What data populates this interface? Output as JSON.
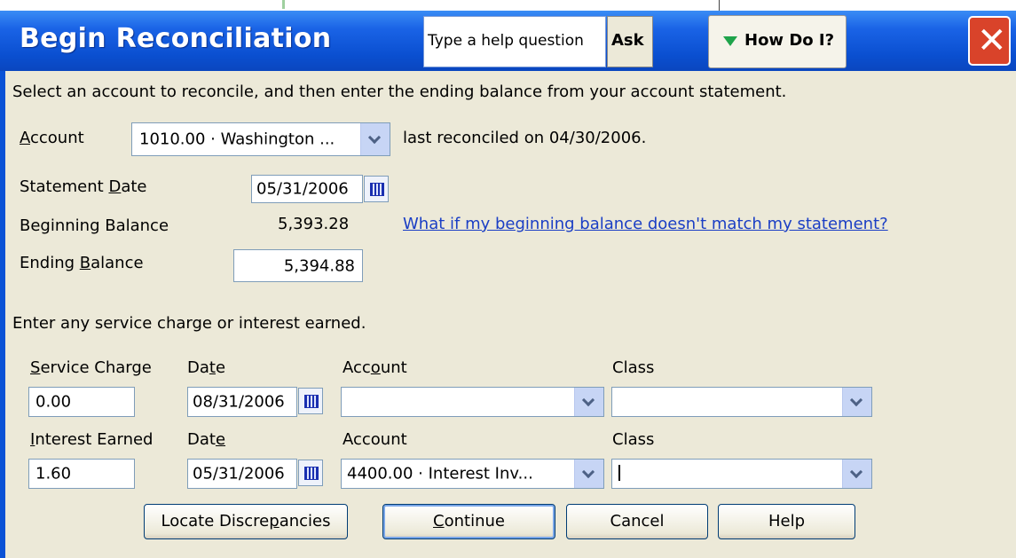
{
  "window": {
    "title": "Begin Reconciliation",
    "help_placeholder": "Type a help question",
    "ask_label": "Ask",
    "howdoi_label": "How Do I?",
    "close_glyph": "✕"
  },
  "intro": "Select an account to reconcile, and then enter the ending balance from your account statement.",
  "account": {
    "label_accel": "A",
    "label_rest": "ccount",
    "value": "1010.00 · Washington ...",
    "last_reconciled": "last reconciled on 04/30/2006."
  },
  "statement_date": {
    "label_pre": "Statement ",
    "label_accel": "D",
    "label_post": "ate",
    "value": "05/31/2006"
  },
  "beginning_balance": {
    "label": "Beginning Balance",
    "value": "5,393.28",
    "help_link": "What if my beginning balance doesn't match my statement?"
  },
  "ending_balance": {
    "label_pre": "Ending ",
    "label_accel": "B",
    "label_post": "alance",
    "value": "5,394.88"
  },
  "charges_intro": "Enter any service charge or interest earned.",
  "service_charge": {
    "label_accel": "S",
    "label_rest": "ervice Charge",
    "value": "0.00",
    "date_label_pre": "Da",
    "date_label_accel": "t",
    "date_label_post": "e",
    "date": "08/31/2006",
    "account_label_pre": "Acc",
    "account_label_accel": "o",
    "account_label_post": "unt",
    "account": "",
    "class_label": "Class",
    "class": ""
  },
  "interest": {
    "label_accel": "I",
    "label_rest": "nterest Earned",
    "value": "1.60",
    "date_label_pre": "Dat",
    "date_label_accel": "e",
    "date_label_post": "",
    "date": "05/31/2006",
    "account_label": "Account",
    "account": "4400.00 · Interest Inv...",
    "class_label": "Class",
    "class": ""
  },
  "buttons": {
    "locate_pre": "Locate Discre",
    "locate_accel": "p",
    "locate_post": "ancies",
    "continue_accel": "C",
    "continue_rest": "ontinue",
    "cancel": "Cancel",
    "help": "Help"
  }
}
